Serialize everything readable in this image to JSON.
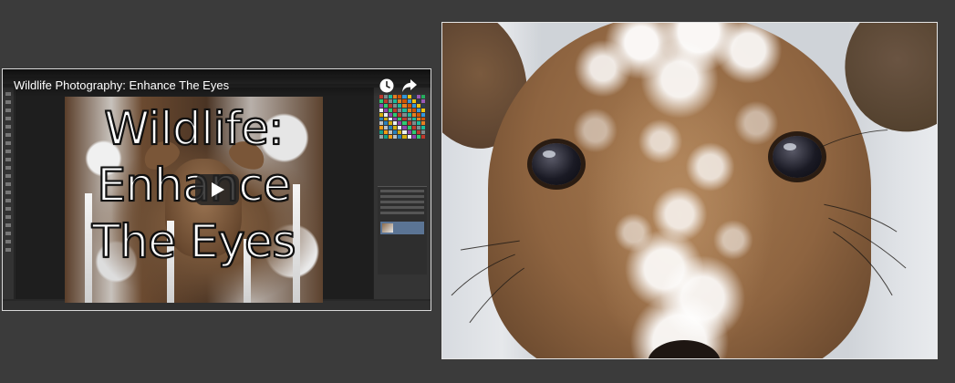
{
  "video": {
    "title": "Wildlife Photography: Enhance The Eyes",
    "thumbnail_text": [
      "Wildlife:",
      "Enhance",
      "The Eyes"
    ],
    "icons": {
      "watch_later": "clock-icon",
      "share": "share-arrow-icon",
      "play": "play-icon"
    },
    "play_button_color": "#232323"
  },
  "photo": {
    "subject": ""
  },
  "colors": {
    "page_background": "#3b3b3b",
    "frame_border": "#e6e6e6"
  }
}
